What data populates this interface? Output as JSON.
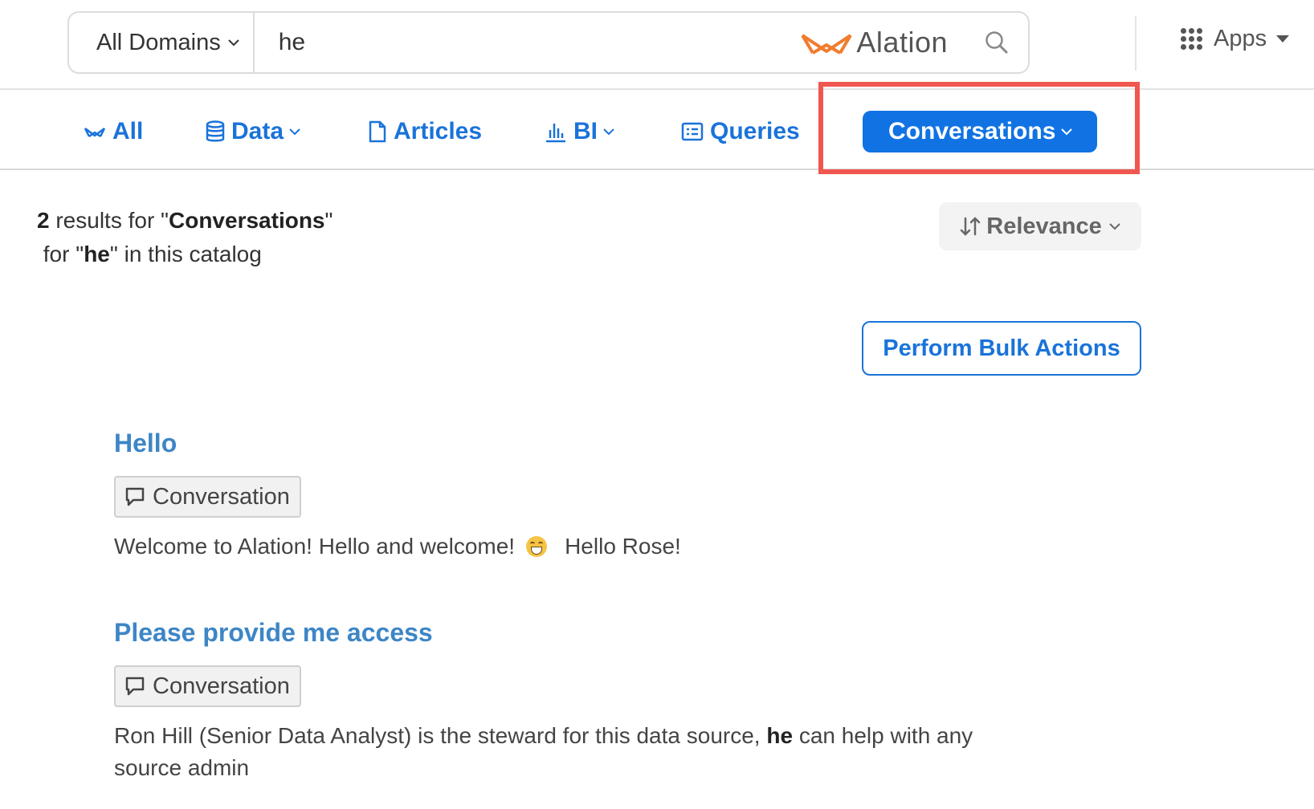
{
  "header": {
    "domain_selector": "All Domains",
    "search_value": "he",
    "brand_name": "Alation",
    "apps_label": "Apps"
  },
  "tabs": [
    {
      "label": "All",
      "icon": "alation-logo-icon",
      "has_dropdown": false,
      "active": false
    },
    {
      "label": "Data",
      "icon": "database-icon",
      "has_dropdown": true,
      "active": false
    },
    {
      "label": "Articles",
      "icon": "document-icon",
      "has_dropdown": false,
      "active": false
    },
    {
      "label": "BI",
      "icon": "bar-chart-icon",
      "has_dropdown": true,
      "active": false
    },
    {
      "label": "Queries",
      "icon": "query-icon",
      "has_dropdown": false,
      "active": false
    },
    {
      "label": "Conversations",
      "icon": "",
      "has_dropdown": true,
      "active": true
    }
  ],
  "results_summary": {
    "count": "2",
    "text_results_for": " results for \"",
    "category": "Conversations",
    "text_for": "\"",
    "text_for2": " for \"",
    "query": "he",
    "text_catalog": "\" in this catalog"
  },
  "sort": {
    "label": "Relevance"
  },
  "bulk_actions_label": "Perform Bulk Actions",
  "results": [
    {
      "title": "Hello",
      "type": "Conversation",
      "snippet_before": "Welcome to Alation! Hello and welcome!",
      "emoji": "grinning-face-emoji",
      "snippet_after": "Hello Rose!"
    },
    {
      "title": "Please provide me access",
      "type": "Conversation",
      "snippet_before": "Ron Hill (Senior Data Analyst) is the steward for this data source, ",
      "snippet_highlight": "he",
      "snippet_after": " can help with any source admin"
    }
  ],
  "colors": {
    "link_blue": "#1a73d9",
    "active_tab_bg": "#1173e3",
    "result_title": "#3d86c6",
    "brand_orange": "#f07c2e",
    "highlight_red": "#f0574e"
  }
}
